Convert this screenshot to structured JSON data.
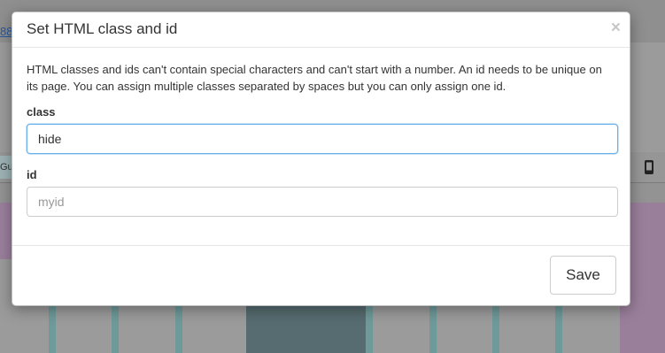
{
  "background": {
    "link_text": "88",
    "tab_label": "Gu"
  },
  "modal": {
    "title": "Set HTML class and id",
    "close_symbol": "×",
    "description": "HTML classes and ids can't contain special characters and can't start with a number. An id needs to be unique on its page. You can assign multiple classes separated by spaces but you can only assign one id.",
    "class_label": "class",
    "class_value": "hide",
    "id_label": "id",
    "id_placeholder": "myid",
    "save_label": "Save"
  },
  "colors": {
    "focus_border": "#66afe9",
    "overlay": "#9b9b9b"
  }
}
